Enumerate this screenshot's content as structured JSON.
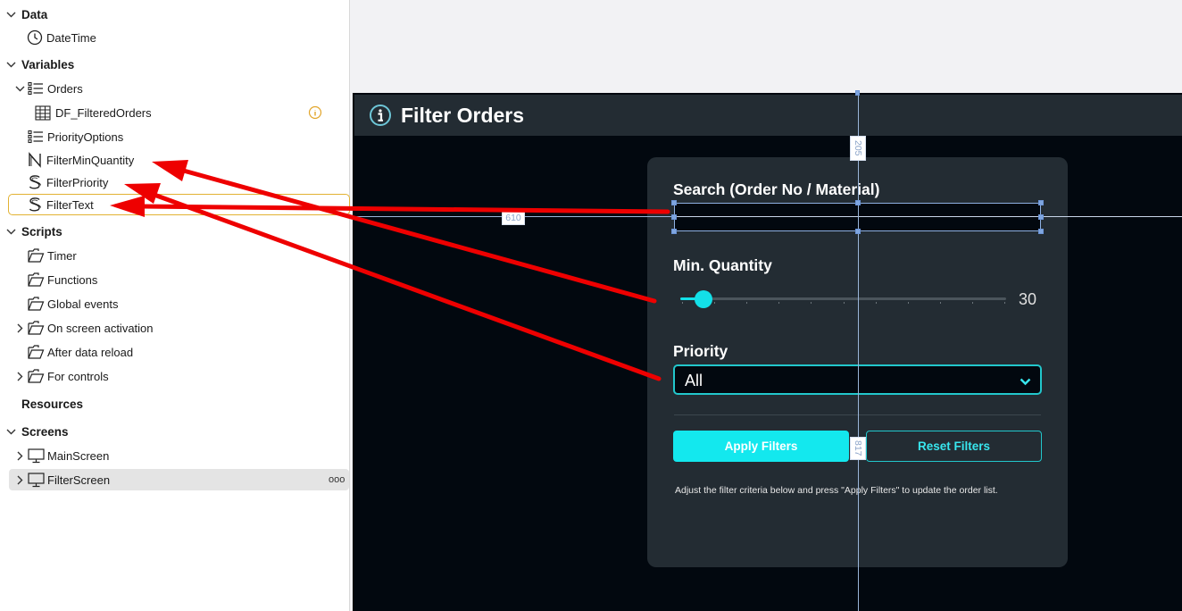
{
  "tree": {
    "sections": {
      "data": "Data",
      "variables": "Variables",
      "scripts": "Scripts",
      "resources": "Resources",
      "screens": "Screens"
    },
    "items": {
      "datetime": "DateTime",
      "orders": "Orders",
      "df_filtered_orders": "DF_FilteredOrders",
      "priority_options": "PriorityOptions",
      "filter_min_quantity": "FilterMinQuantity",
      "filter_priority": "FilterPriority",
      "filter_text": "FilterText",
      "timer": "Timer",
      "functions": "Functions",
      "global_events": "Global events",
      "on_screen_activation": "On screen activation",
      "after_data_reload": "After data reload",
      "for_controls": "For controls",
      "main_screen": "MainScreen",
      "filter_screen": "FilterScreen"
    },
    "more_label": "ooo"
  },
  "canvas": {
    "header_title": "Filter Orders",
    "search_label": "Search (Order No / Material)",
    "search_value": "",
    "min_quantity_label": "Min. Quantity",
    "min_quantity_value": "30",
    "min_quantity_fraction": 0.07,
    "priority_label": "Priority",
    "priority_value": "All",
    "apply_button": "Apply Filters",
    "reset_button": "Reset Filters",
    "hint": "Adjust the filter criteria below and press \"Apply Filters\" to update the order list.",
    "guide_labels": {
      "top": "205",
      "left": "610",
      "bottom": "817"
    }
  },
  "colors": {
    "accent": "#13e8ee",
    "arrow": "#ee0000",
    "selection_outline": "#e2b233",
    "card": "#232c33",
    "screen_bg": "#02080f"
  }
}
